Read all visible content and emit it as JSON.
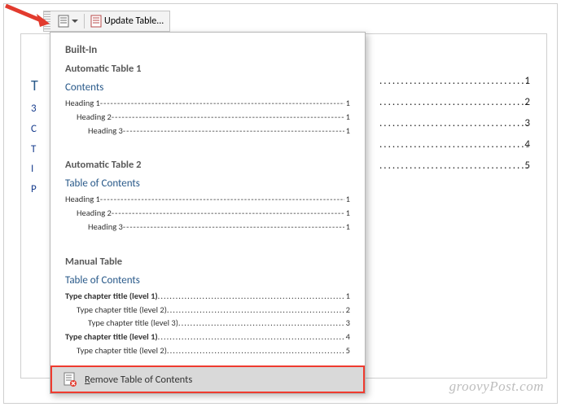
{
  "toolbar": {
    "toc_button_icon": "toc-icon",
    "update_label": "Update Table..."
  },
  "doc_behind": {
    "left_letters": [
      "T",
      "3",
      "C",
      "T",
      "I",
      "P"
    ],
    "right_numbers": [
      "1",
      "2",
      "3",
      "4",
      "5"
    ]
  },
  "gallery": {
    "header": "Built-In",
    "groups": [
      {
        "title": "Automatic Table 1",
        "toc_heading": "Contents",
        "entries": [
          {
            "label": "Heading 1",
            "page": "1",
            "indent": 0
          },
          {
            "label": "Heading 2",
            "page": "1",
            "indent": 1
          },
          {
            "label": "Heading 3",
            "page": "1",
            "indent": 2
          }
        ]
      },
      {
        "title": "Automatic Table 2",
        "toc_heading": "Table of Contents",
        "entries": [
          {
            "label": "Heading 1",
            "page": "1",
            "indent": 0
          },
          {
            "label": "Heading 2",
            "page": "1",
            "indent": 1
          },
          {
            "label": "Heading 3",
            "page": "1",
            "indent": 2
          }
        ]
      },
      {
        "title": "Manual Table",
        "toc_heading": "Table of Contents",
        "entries": [
          {
            "label": "Type chapter title (level 1)",
            "page": "1",
            "indent": 0,
            "bold": true
          },
          {
            "label": "Type chapter title (level 2)",
            "page": "2",
            "indent": 1
          },
          {
            "label": "Type chapter title (level 3)",
            "page": "3",
            "indent": 2
          },
          {
            "label": "Type chapter title (level 1)",
            "page": "4",
            "indent": 0,
            "bold": true
          },
          {
            "label": "Type chapter title (level 2)",
            "page": "5",
            "indent": 1
          }
        ]
      }
    ],
    "remove_label": "Remove Table of Contents"
  },
  "watermark": "groovyPost.com",
  "leader_fill": "--------------------------------------------------------------------------------------------------------------------",
  "dot_fill": "........................................................................................................................................................"
}
